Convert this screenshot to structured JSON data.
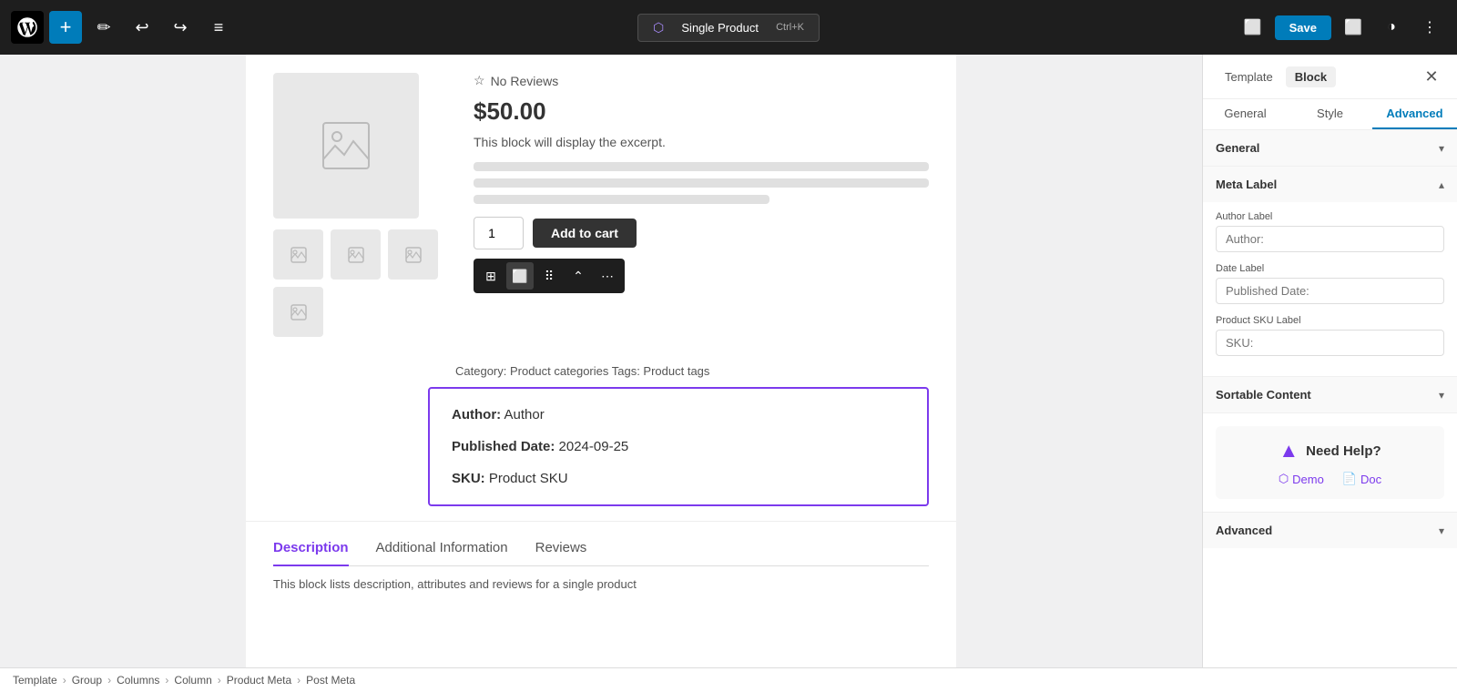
{
  "topbar": {
    "add_label": "+",
    "edit_label": "✏",
    "undo_label": "↩",
    "redo_label": "↪",
    "list_label": "≡",
    "doc_title": "Single Product",
    "shortcut": "Ctrl+K",
    "save_label": "Save",
    "screen_icon": "⬜",
    "contrast_icon": "◑",
    "more_icon": "⋮"
  },
  "product": {
    "no_reviews": "No Reviews",
    "price": "$50.00",
    "excerpt": "This block will display the excerpt.",
    "quantity": "1",
    "add_to_cart": "Add to cart",
    "cat_tags": "Category: Product categories   Tags: Product tags",
    "meta_author_label": "Author:",
    "meta_author_value": "Author",
    "meta_date_label": "Published Date:",
    "meta_date_value": "2024-09-25",
    "meta_sku_label": "SKU:",
    "meta_sku_value": "Product SKU"
  },
  "tabs": {
    "description": "Description",
    "additional_information": "Additional Information",
    "reviews": "Reviews",
    "tab_desc_text": "This block lists description, attributes and reviews for a single product"
  },
  "right_panel": {
    "tab_template": "Template",
    "tab_block": "Block",
    "close_icon": "✕",
    "sub_tab_general": "General",
    "sub_tab_style": "Style",
    "sub_tab_advanced": "Advanced",
    "section_general": "General",
    "section_meta_label": "Meta Label",
    "field_author_label": "Author Label",
    "field_author_placeholder": "Author:",
    "field_date_label": "Date Label",
    "field_date_placeholder": "Published Date:",
    "field_sku_label": "Product SKU Label",
    "field_sku_placeholder": "SKU:",
    "section_sortable": "Sortable Content",
    "need_help_title": "Need Help?",
    "need_help_demo": "Demo",
    "need_help_doc": "Doc",
    "advanced_title": "Advanced"
  },
  "breadcrumb": {
    "items": [
      "Template",
      "Group",
      "Columns",
      "Column",
      "Product Meta",
      "Post Meta"
    ]
  }
}
